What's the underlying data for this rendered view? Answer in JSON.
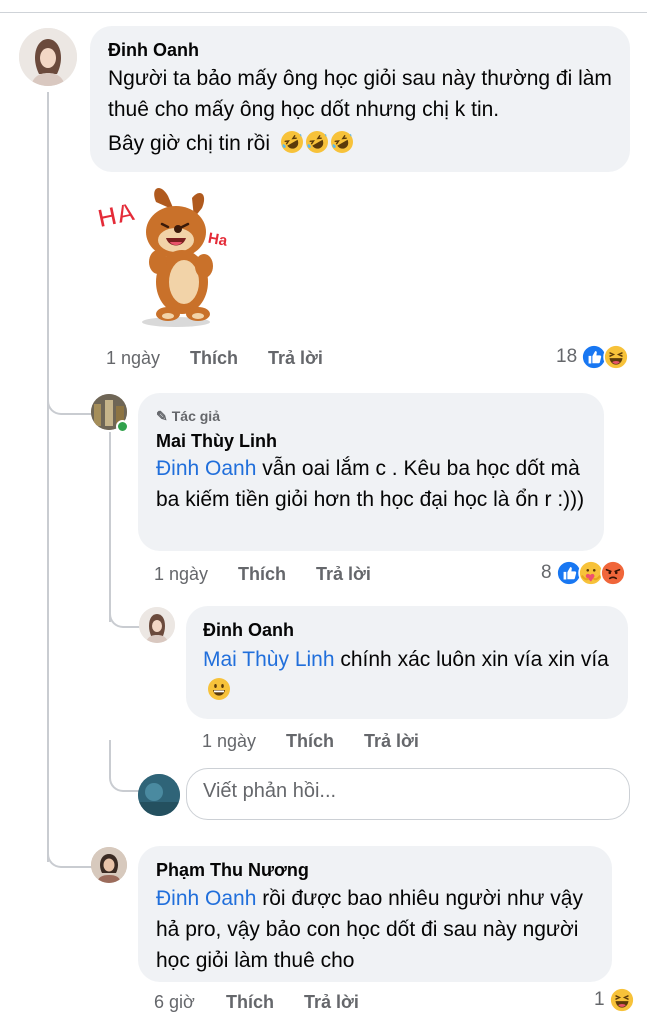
{
  "comments": [
    {
      "author": "Đinh Oanh",
      "text": "Người ta bảo mấy ông học giỏi sau này thường đi làm thuê cho mấy ông học dốt nhưng chị k tin.",
      "text_line2": "Bây giờ chị tin rồi",
      "emoji": "🤣🤣🤣",
      "sticker": {
        "label": "HA",
        "label2": "Ha"
      },
      "time": "1 ngày",
      "like_label": "Thích",
      "reply_label": "Trả lời",
      "reaction_count": "18",
      "reactions": [
        "like-icon",
        "haha-icon"
      ]
    },
    {
      "author_tag": "Tác giả",
      "author": "Mai Thùy Linh",
      "mention": "Đinh Oanh",
      "text": " vẫn oai lắm c . Kêu ba học dốt mà ba kiếm tiền giỏi hơn th học đại học là ổn r :)))",
      "time": "1 ngày",
      "like_label": "Thích",
      "reply_label": "Trả lời",
      "reaction_count": "8",
      "reactions": [
        "like-icon",
        "care-icon",
        "angry-icon"
      ]
    },
    {
      "author": "Đinh Oanh",
      "mention": "Mai Thùy Linh",
      "text": " chính xác luôn xin vía xin vía",
      "emoji": "😃",
      "time": "1 ngày",
      "like_label": "Thích",
      "reply_label": "Trả lời"
    },
    {
      "author": "Phạm Thu Nương",
      "mention": "Đinh Oanh",
      "text": " rồi được bao nhiêu người như vậy hả pro, vậy bảo con học dốt đi sau này người học giỏi làm thuê cho",
      "time": "6 giờ",
      "like_label": "Thích",
      "reply_label": "Trả lời",
      "reaction_count": "1",
      "reactions": [
        "haha-icon"
      ]
    }
  ],
  "reply_box": {
    "placeholder": "Viết phản hồi..."
  },
  "colors": {
    "mention": "#216fdb",
    "bubble": "#f0f2f5",
    "meta": "#65676b",
    "like": "#1877f2"
  }
}
